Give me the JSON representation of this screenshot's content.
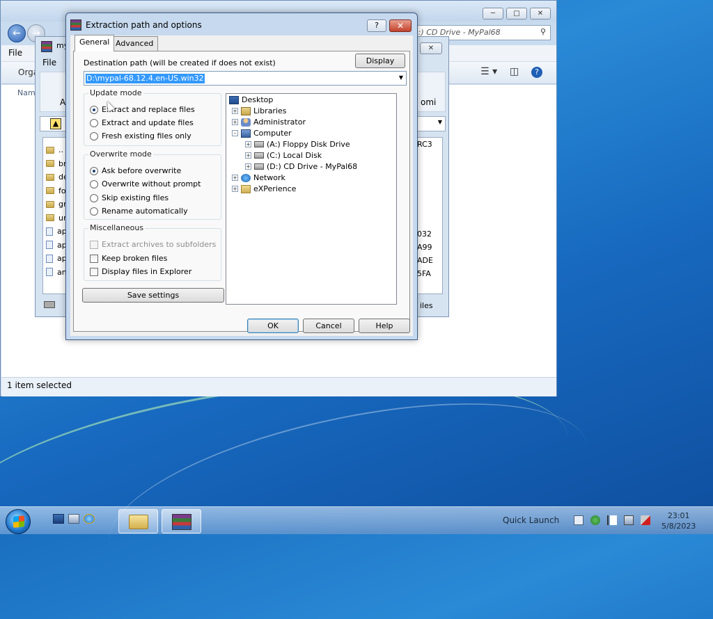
{
  "explorer": {
    "address": "(D:) CD Drive - MyPal68",
    "menu_file": "File",
    "cmd_organize": "Orga",
    "col_name": "Nam",
    "status": "1 item selected"
  },
  "winrar": {
    "title_fragment": "my",
    "menu_file": "File",
    "toolbar_fragment_left": "A",
    "toolbar_fragment_right": "omi",
    "list_rows": [
      "..",
      "br",
      "de",
      "fo",
      "gr",
      "ur",
      "ap",
      "ap",
      "ap",
      "an"
    ],
    "right_col": [
      "RC3",
      "032",
      "A99",
      "ADE",
      "5FA"
    ],
    "status_right": "iles"
  },
  "dialog": {
    "title": "Extraction path and options",
    "help_btn": "?",
    "close_btn": "✕",
    "tabs": {
      "general": "General",
      "advanced": "Advanced"
    },
    "dest_label": "Destination path (will be created if does not exist)",
    "display_btn": "Display",
    "dest_value": "D:\\mypal-68.12.4.en-US.win32",
    "update_mode": {
      "title": "Update mode",
      "options": [
        "Extract and replace files",
        "Extract and update files",
        "Fresh existing files only"
      ]
    },
    "overwrite_mode": {
      "title": "Overwrite mode",
      "options": [
        "Ask before overwrite",
        "Overwrite without prompt",
        "Skip existing files",
        "Rename automatically"
      ]
    },
    "misc": {
      "title": "Miscellaneous",
      "options": [
        "Extract archives to subfolders",
        "Keep broken files",
        "Display files in Explorer"
      ]
    },
    "save_btn": "Save settings",
    "tree": [
      "Desktop",
      "Libraries",
      "Administrator",
      "Computer",
      "(A:) Floppy Disk Drive",
      "(C:) Local Disk",
      "(D:) CD Drive - MyPal68",
      "Network",
      "eXPerience"
    ],
    "ok_btn": "OK",
    "cancel_btn": "Cancel",
    "help_button": "Help"
  },
  "taskbar": {
    "quick_launch": "Quick Launch",
    "time": "23:01",
    "date": "5/8/2023"
  }
}
